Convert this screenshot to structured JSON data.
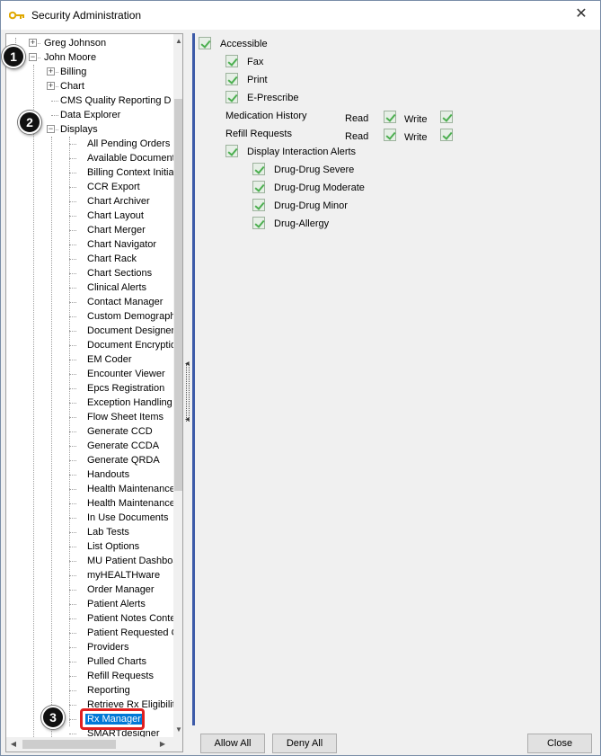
{
  "window": {
    "title": "Security Administration",
    "close_symbol": "✕"
  },
  "tree": {
    "rows": [
      {
        "label": "Greg Johnson",
        "expander": "+"
      },
      {
        "label": "John Moore",
        "expander": "−"
      },
      {
        "label": "Billing",
        "expander": "+"
      },
      {
        "label": "Chart",
        "expander": "+"
      },
      {
        "label": "CMS Quality Reporting D"
      },
      {
        "label": "Data Explorer"
      },
      {
        "label": "Displays",
        "expander": "−"
      },
      {
        "label": "All Pending Orders"
      },
      {
        "label": "Available Document"
      },
      {
        "label": "Billing Context Initializ"
      },
      {
        "label": "CCR Export"
      },
      {
        "label": "Chart Archiver"
      },
      {
        "label": "Chart Layout"
      },
      {
        "label": "Chart Merger"
      },
      {
        "label": "Chart Navigator"
      },
      {
        "label": "Chart Rack"
      },
      {
        "label": "Chart Sections"
      },
      {
        "label": "Clinical Alerts"
      },
      {
        "label": "Contact Manager"
      },
      {
        "label": "Custom Demographic"
      },
      {
        "label": "Document Designer"
      },
      {
        "label": "Document Encryption"
      },
      {
        "label": "EM Coder"
      },
      {
        "label": "Encounter Viewer"
      },
      {
        "label": "Epcs Registration"
      },
      {
        "label": "Exception Handling"
      },
      {
        "label": "Flow Sheet Items"
      },
      {
        "label": "Generate CCD"
      },
      {
        "label": "Generate CCDA"
      },
      {
        "label": "Generate QRDA"
      },
      {
        "label": "Handouts"
      },
      {
        "label": "Health Maintenance"
      },
      {
        "label": "Health Maintenance"
      },
      {
        "label": "In Use Documents"
      },
      {
        "label": "Lab Tests"
      },
      {
        "label": "List Options"
      },
      {
        "label": "MU Patient Dashboa"
      },
      {
        "label": "myHEALTHware"
      },
      {
        "label": "Order Manager"
      },
      {
        "label": "Patient Alerts"
      },
      {
        "label": "Patient Notes Contex"
      },
      {
        "label": "Patient Requested C"
      },
      {
        "label": "Providers"
      },
      {
        "label": "Pulled Charts"
      },
      {
        "label": "Refill Requests"
      },
      {
        "label": "Reporting"
      },
      {
        "label": "Retrieve Rx Eligibility"
      },
      {
        "label": "Rx Manager",
        "selected": true
      },
      {
        "label": "SMARTdesigner"
      }
    ],
    "scroll_symbols": {
      "up": "▲",
      "down": "▼",
      "left": "◀",
      "right": "▶"
    }
  },
  "permissions": {
    "accessible": "Accessible",
    "fax": "Fax",
    "print": "Print",
    "eprescribe": "E-Prescribe",
    "medication_history": "Medication History",
    "refill_requests": "Refill Requests",
    "read": "Read",
    "write": "Write",
    "display_interaction_alerts": "Display Interaction Alerts",
    "ddi_severe": "Drug-Drug Severe",
    "ddi_moderate": "Drug-Drug Moderate",
    "ddi_minor": "Drug-Drug Minor",
    "drug_allergy": "Drug-Allergy"
  },
  "buttons": {
    "allow_all": "Allow All",
    "deny_all": "Deny All",
    "close": "Close"
  },
  "callouts": [
    "1",
    "2",
    "3"
  ],
  "colors": {
    "selection": "#0078d7",
    "highlight": "#e02020",
    "accent_border": "#3c5aa8"
  }
}
